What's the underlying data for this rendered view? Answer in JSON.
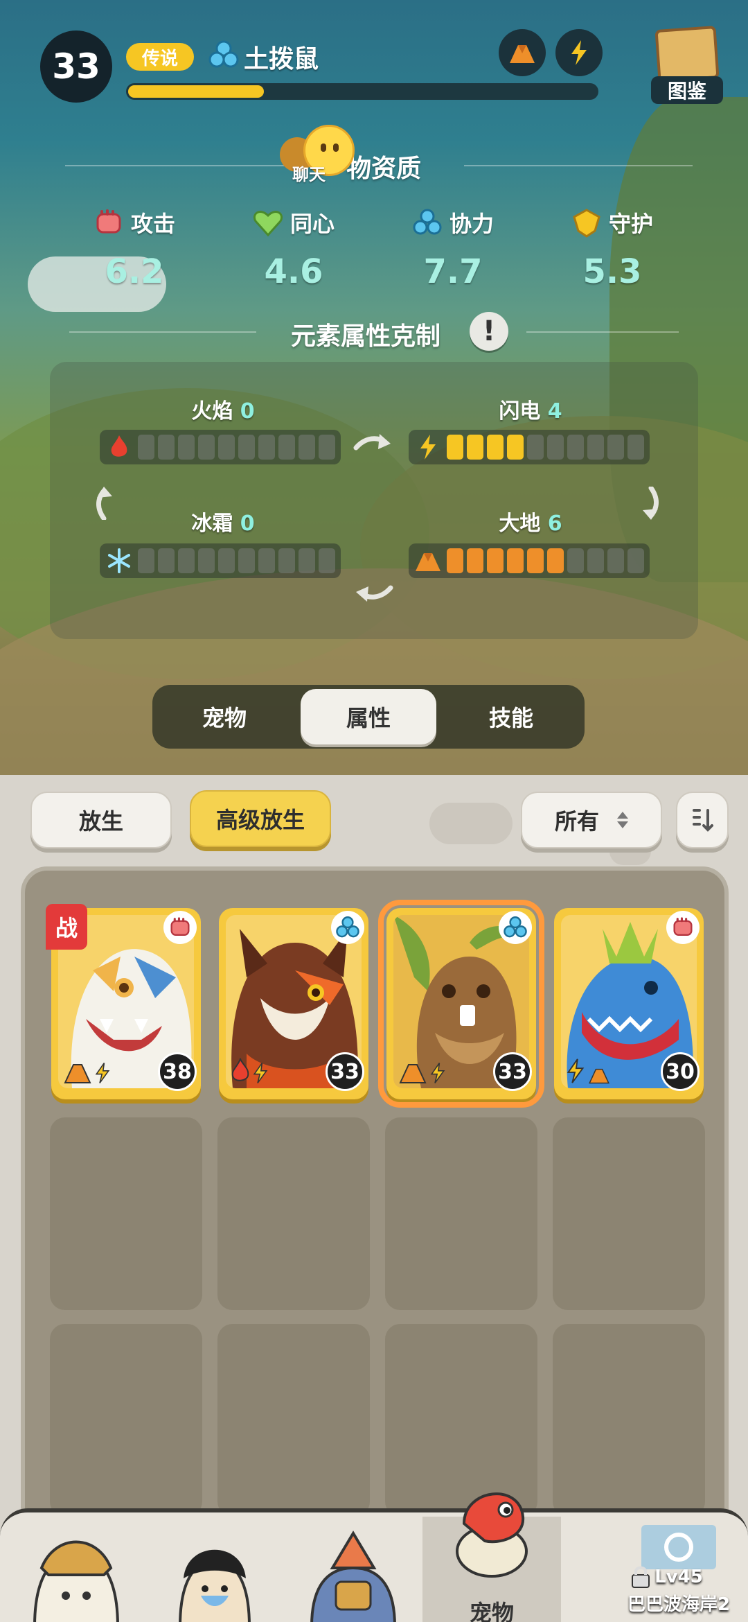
{
  "header": {
    "level": "33",
    "rarity": "传说",
    "pet_name": "土拨鼠",
    "xp_fraction": 0.29,
    "codex_label": "图鉴"
  },
  "chat": {
    "label": "聊天"
  },
  "aptitude": {
    "title": "物资质",
    "stats": [
      {
        "label": "攻击",
        "value": "6.2",
        "icon": "attack-fist-icon"
      },
      {
        "label": "同心",
        "value": "4.6",
        "icon": "heart-icon"
      },
      {
        "label": "协力",
        "value": "7.7",
        "icon": "teamwork-icon"
      },
      {
        "label": "守护",
        "value": "5.3",
        "icon": "shield-icon"
      }
    ]
  },
  "elements": {
    "title": "元素属性克制",
    "fire": {
      "label": "火焰",
      "value": "0",
      "level": 0,
      "max": 10
    },
    "lightning": {
      "label": "闪电",
      "value": "4",
      "level": 4,
      "max": 10
    },
    "ice": {
      "label": "冰霜",
      "value": "0",
      "level": 0,
      "max": 10
    },
    "earth": {
      "label": "大地",
      "value": "6",
      "level": 6,
      "max": 10
    }
  },
  "tabs": [
    {
      "label": "宠物",
      "active": false
    },
    {
      "label": "属性",
      "active": true
    },
    {
      "label": "技能",
      "active": false
    }
  ],
  "actions": {
    "release": "放生",
    "advanced_release": "高级放生",
    "filter": "所有"
  },
  "pets": [
    {
      "level": "38",
      "element": "attack",
      "tag": "战",
      "types": [
        "earth",
        "lightning"
      ]
    },
    {
      "level": "33",
      "element": "teamwork",
      "tag": "",
      "types": [
        "fire",
        "lightning"
      ]
    },
    {
      "level": "33",
      "element": "teamwork",
      "tag": "",
      "types": [
        "earth",
        "lightning"
      ]
    },
    {
      "level": "30",
      "element": "attack",
      "tag": "",
      "types": [
        "lightning",
        "earth"
      ]
    }
  ],
  "nav": {
    "pets_label": "宠物",
    "region_level": "Lv45",
    "region_name": "巴巴波海岸2"
  },
  "colors": {
    "accent_yellow": "#f6c623",
    "stat_value": "#a9f0e2",
    "lightning": "#f6c623",
    "earth": "#ee8f2a",
    "selected_outline": "#ff9a3d"
  }
}
